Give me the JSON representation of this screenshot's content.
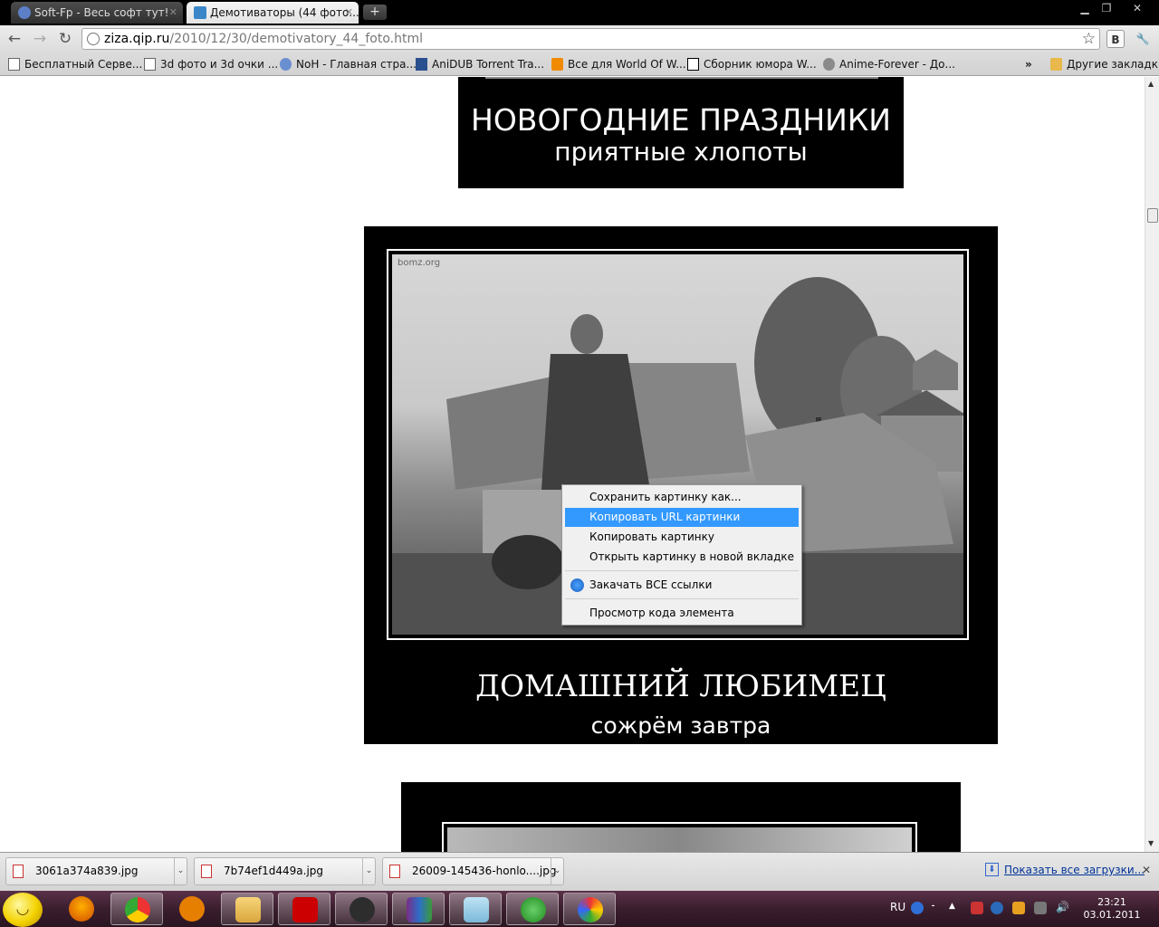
{
  "tabs": [
    {
      "title": "Soft-Fp - Весь софт тут!",
      "active": false
    },
    {
      "title": "Демотиваторы (44 фото...",
      "active": true
    }
  ],
  "window_controls": {
    "minimize": "▁",
    "maximize": "❐",
    "close": "✕"
  },
  "address_bar": {
    "host": "ziza.qip.ru",
    "path": "/2010/12/30/demotivatory_44_foto.html"
  },
  "bookmarks": [
    {
      "label": "Бесплатный Серве...",
      "icon": "page-icon"
    },
    {
      "label": "3d фото и 3d очки ...",
      "icon": "page-icon"
    },
    {
      "label": "NoH - Главная стра...",
      "icon": "noh-icon"
    },
    {
      "label": "AniDUB Torrent Tra...",
      "icon": "anidub-icon"
    },
    {
      "label": "Все для World Of W...",
      "icon": "blog-icon"
    },
    {
      "label": "Сборник юмора W...",
      "icon": "lol-icon"
    },
    {
      "label": "Anime-Forever - До...",
      "icon": "anime-icon"
    }
  ],
  "bookmarks_overflow": "»",
  "other_bookmarks": "Другие закладки",
  "extension_label": "B",
  "page": {
    "demot1": {
      "line1": "НОВОГОДНИЕ ПРАЗДНИКИ",
      "line2": "приятные хлопоты"
    },
    "demot2": {
      "watermark": "bomz.org",
      "line1": "ДОМАШНИЙ ЛЮБИМЕЦ",
      "line2": "сожрём завтра"
    }
  },
  "context_menu": [
    {
      "label": "Сохранить картинку как...",
      "highlighted": false
    },
    {
      "label": "Копировать URL картинки",
      "highlighted": true
    },
    {
      "label": "Копировать картинку",
      "highlighted": false
    },
    {
      "label": "Открыть картинку в новой вкладке",
      "highlighted": false
    },
    {
      "label": "Закачать ВСЕ ссылки",
      "highlighted": false,
      "icon": "download-master-icon"
    },
    {
      "label": "Просмотр кода элемента",
      "highlighted": false
    }
  ],
  "downloads": [
    {
      "file": "3061a374a839.jpg"
    },
    {
      "file": "7b74ef1d449a.jpg"
    },
    {
      "file": "26009-145436-honlo....jpg"
    }
  ],
  "show_all_downloads": "Показать все загрузки...",
  "taskbar": {
    "apps": [
      "firefox-icon",
      "chrome-icon",
      "mail-ru-agent-icon",
      "explorer-folder-icon",
      "acrobat-icon",
      "steam-icon",
      "winrar-icon",
      "notepad-icon",
      "utorrent-icon",
      "paint-icon"
    ],
    "language": "RU",
    "time": "23:21",
    "date": "03.01.2011"
  }
}
